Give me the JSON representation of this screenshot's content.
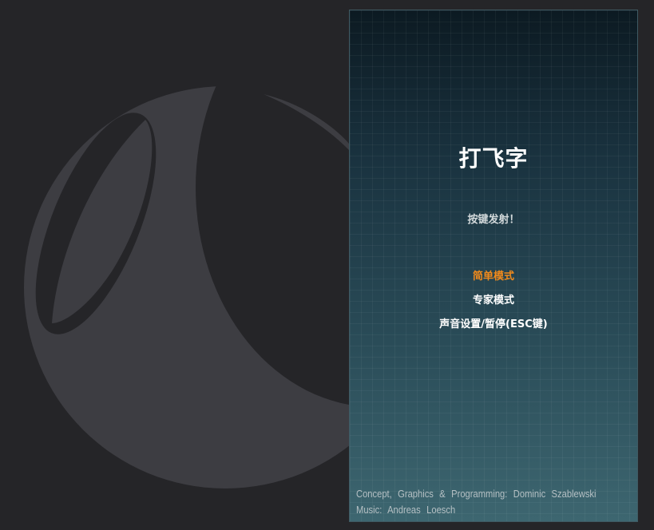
{
  "game": {
    "title": "打飞字",
    "subtitle": "按键发射！",
    "menu": {
      "easy": "简单模式",
      "expert": "专家模式",
      "settings": "声音设置/暂停(ESC键)"
    },
    "credits": {
      "line1": "Concept, Graphics & Programming: Dominic Szablewski",
      "line2": "Music: Andreas Loesch"
    }
  },
  "colors": {
    "background": "#252528",
    "logo": "#3d3d42",
    "menu_active": "#f08a1c",
    "menu_text": "#ffffff"
  },
  "icons": {
    "background_logo": "crescent-sphere-logo"
  }
}
